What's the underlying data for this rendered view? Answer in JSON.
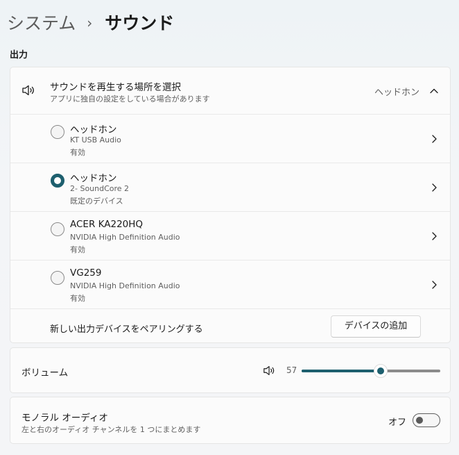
{
  "breadcrumb": {
    "parent": "システム",
    "separator": "›",
    "current": "サウンド"
  },
  "output": {
    "section_title": "出力",
    "header": {
      "icon": "speaker-icon",
      "title": "サウンドを再生する場所を選択",
      "subtitle": "アプリに独自の設定をしている場合があります",
      "value": "ヘッドホン",
      "expanded": true
    },
    "devices": [
      {
        "name": "ヘッドホン",
        "driver": "KT USB Audio",
        "status": "有効",
        "selected": false
      },
      {
        "name": "ヘッドホン",
        "driver": "2- SoundCore 2",
        "status": "既定のデバイス",
        "selected": true
      },
      {
        "name": "ACER KA220HQ",
        "driver": "NVIDIA High Definition Audio",
        "status": "有効",
        "selected": false
      },
      {
        "name": "VG259",
        "driver": "NVIDIA High Definition Audio",
        "status": "有効",
        "selected": false
      }
    ],
    "pair_label": "新しい出力デバイスをペアリングする",
    "add_button": "デバイスの追加"
  },
  "volume": {
    "label": "ボリューム",
    "value": "57",
    "level": 0.57
  },
  "mono": {
    "title": "モノラル オーディオ",
    "subtitle": "左と右のオーディオ チャンネルを 1 つにまとめます",
    "toggle_label": "オフ",
    "enabled": false
  },
  "colors": {
    "accent": "#1d5f6e",
    "background": "#f3f5f7",
    "card": "#fbfbfb"
  }
}
